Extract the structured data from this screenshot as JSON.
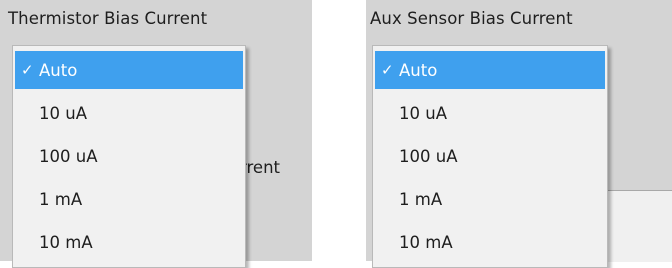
{
  "left_panel": {
    "title": "Thermistor Bias Current",
    "partial_text_behind": "rrent",
    "dropdown": {
      "check_glyph": "✓",
      "options": [
        {
          "label": "Auto",
          "selected": true
        },
        {
          "label": "10 uA",
          "selected": false
        },
        {
          "label": "100 uA",
          "selected": false
        },
        {
          "label": "1 mA",
          "selected": false
        },
        {
          "label": "10 mA",
          "selected": false
        }
      ]
    }
  },
  "right_panel": {
    "title": "Aux Sensor Bias Current",
    "dropdown": {
      "check_glyph": "✓",
      "options": [
        {
          "label": "Auto",
          "selected": true
        },
        {
          "label": "10 uA",
          "selected": false
        },
        {
          "label": "100 uA",
          "selected": false
        },
        {
          "label": "1 mA",
          "selected": false
        },
        {
          "label": "10 mA",
          "selected": false
        }
      ]
    }
  },
  "colors": {
    "selected_highlight": "#3fa0ee",
    "panel_background": "#d4d4d4",
    "menu_background": "#f1f1f1"
  }
}
